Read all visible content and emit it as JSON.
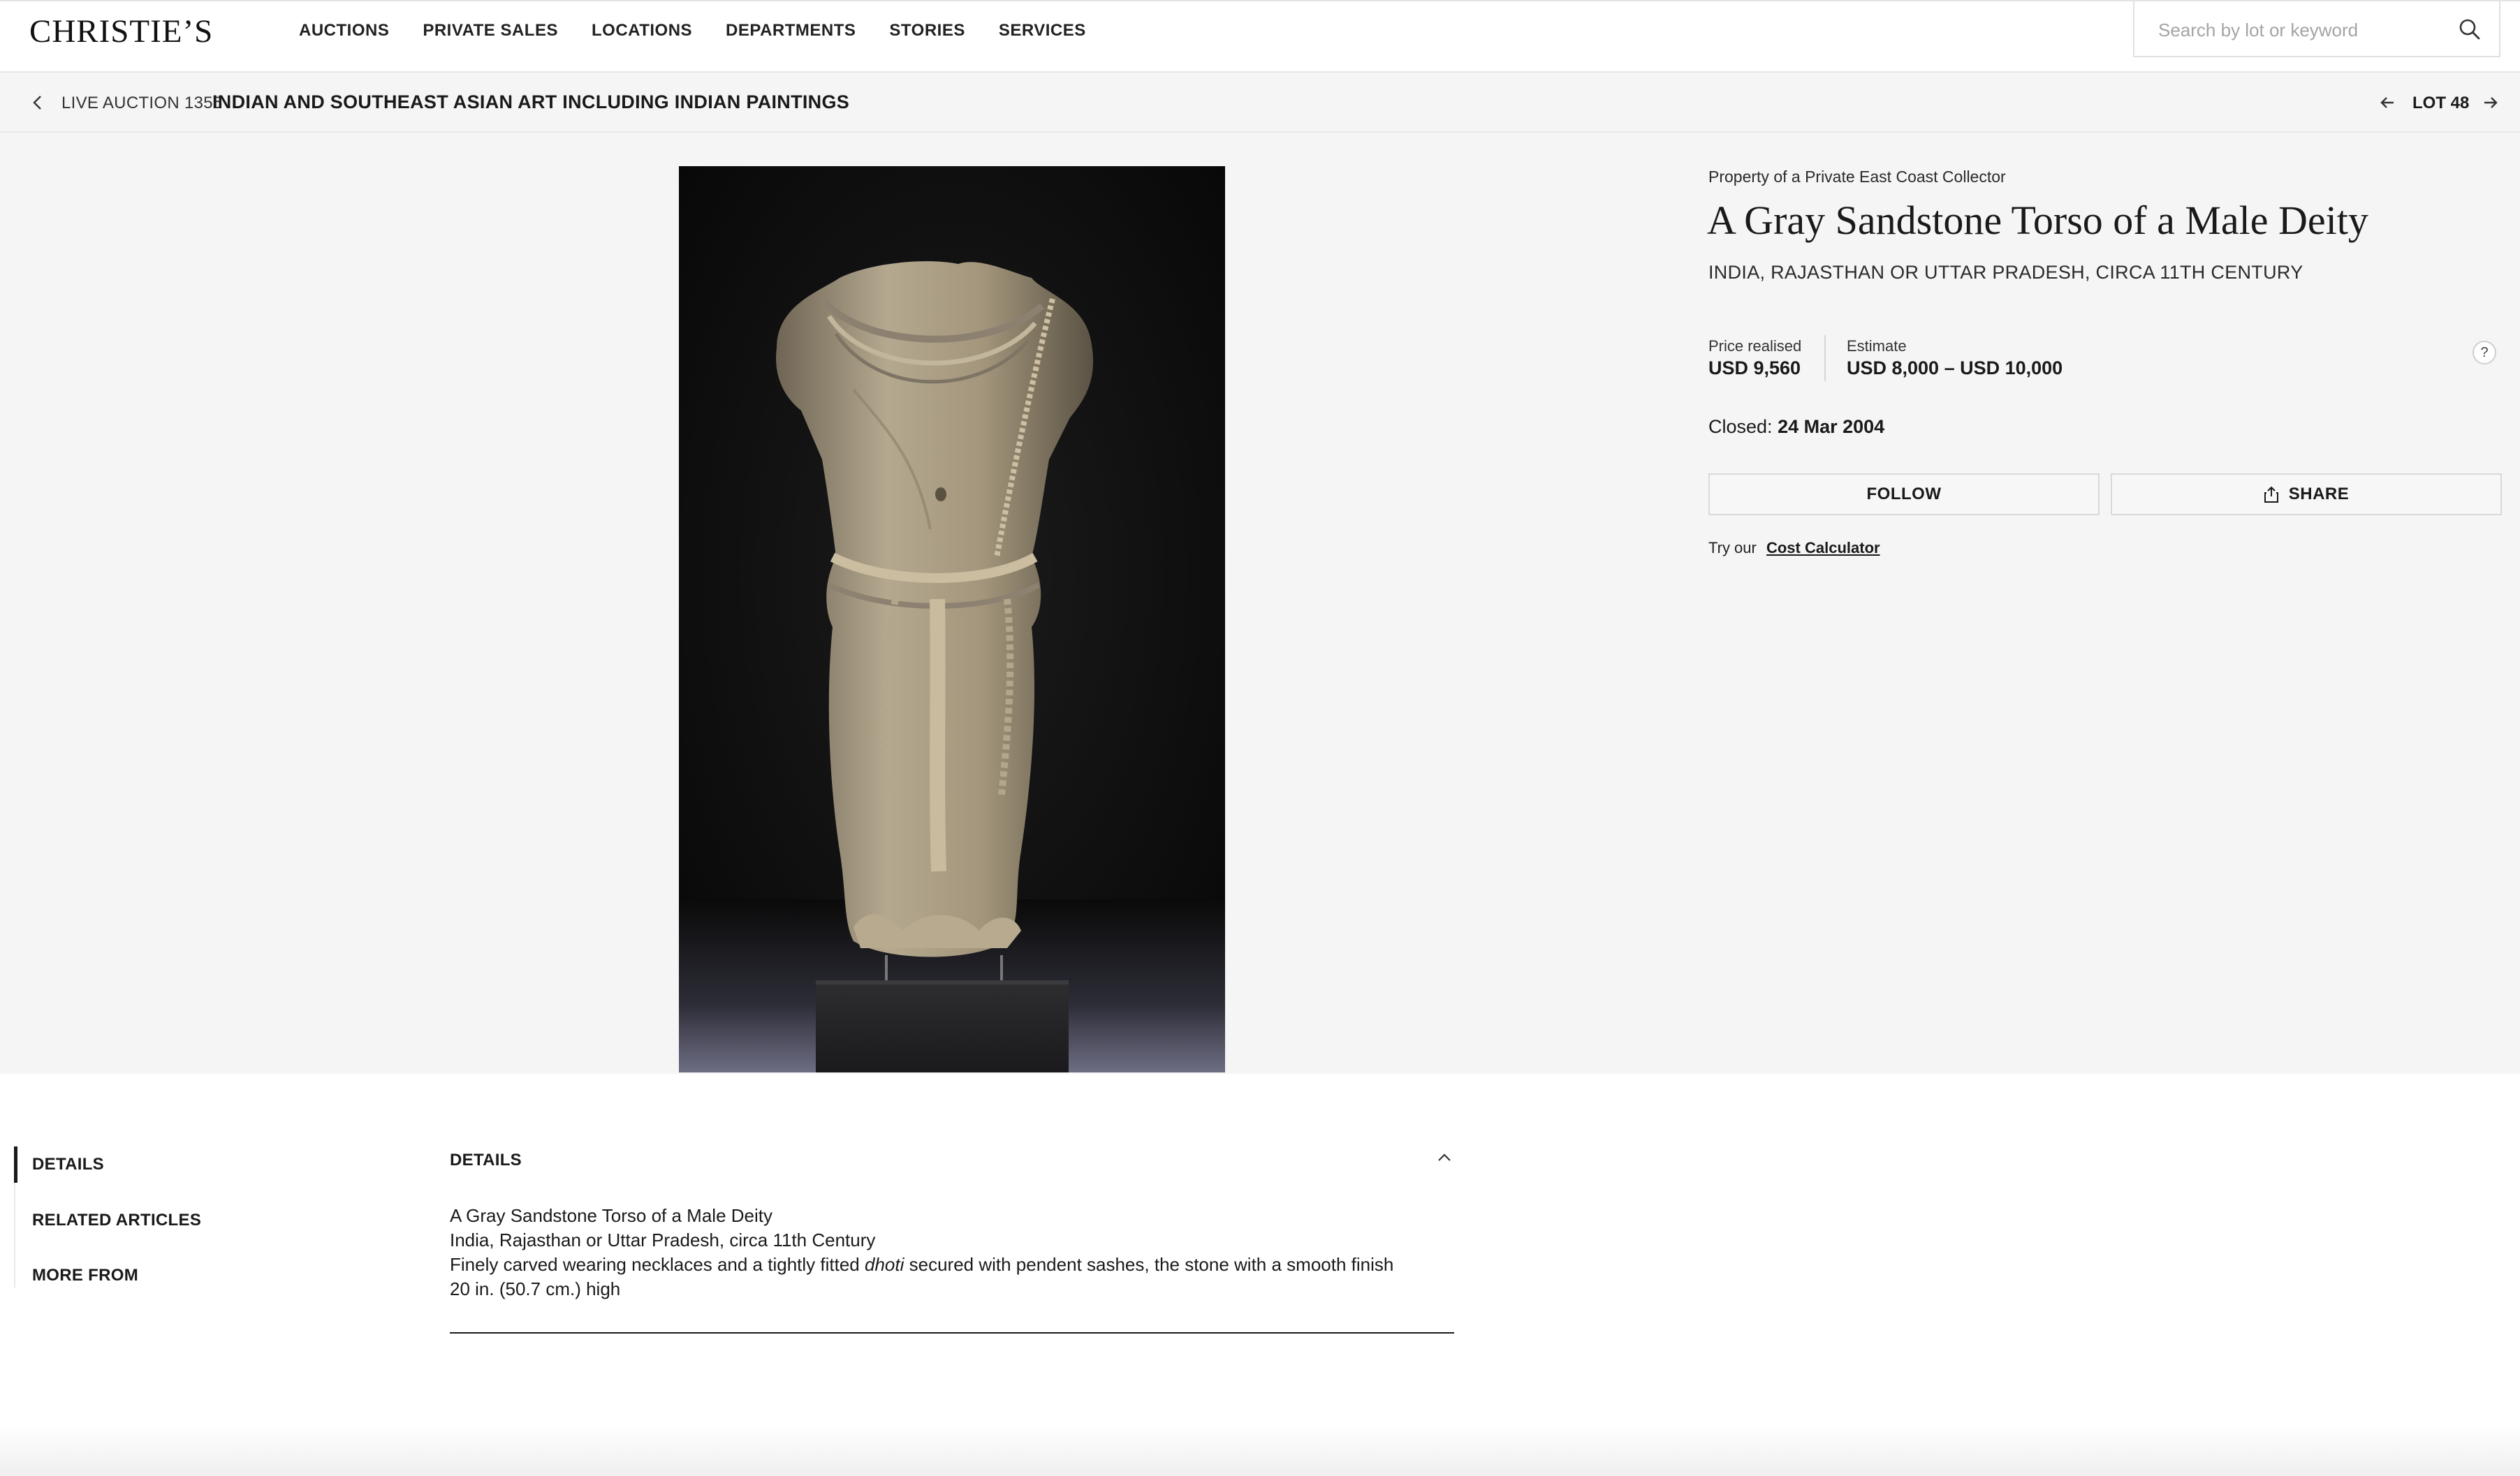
{
  "header": {
    "logo": "CHRISTIE’S",
    "nav": [
      "AUCTIONS",
      "PRIVATE SALES",
      "LOCATIONS",
      "DEPARTMENTS",
      "STORIES",
      "SERVICES"
    ],
    "search_placeholder": "Search by lot or keyword",
    "search_icon": "magnifier"
  },
  "breadcrumb": {
    "sale_label": "LIVE AUCTION 1355",
    "sale_title": "INDIAN AND SOUTHEAST ASIAN ART INCLUDING INDIAN PAINTINGS",
    "lot": "LOT 48"
  },
  "lot": {
    "provenance": "Property of a Private East Coast Collector",
    "title": "A Gray Sandstone Torso of a Male Deity",
    "subtitle": "INDIA, RAJASTHAN OR UTTAR PRADESH, CIRCA 11TH CENTURY",
    "price_label": "Price realised",
    "price_value": "USD 9,560",
    "estimate_label": "Estimate",
    "estimate_value": "USD 8,000 – USD 10,000",
    "help": "?",
    "closed_label": "Closed:",
    "closed_date": "24 Mar 2004",
    "follow_label": "FOLLOW",
    "share_label": "SHARE",
    "calc_prefix": "Try our",
    "calc_link": "Cost Calculator"
  },
  "sidebar": {
    "items": [
      "DETAILS",
      "RELATED ARTICLES",
      "MORE FROM"
    ]
  },
  "details": {
    "heading": "DETAILS",
    "line1": "A Gray Sandstone Torso of a Male Deity",
    "line2": "India, Rajasthan or Uttar Pradesh, circa 11th Century",
    "line3_before": "Finely carved wearing necklaces and a tightly fitted",
    "line3_italic": "dhoti",
    "line3_after": "secured with pendent sashes, the stone with a smooth finish",
    "line4": "20 in. (50.7 cm.) high"
  },
  "colors": {
    "background_band": "#f5f5f5",
    "text": "#1a1a1a",
    "image_backdrop": "#0b0b0b"
  }
}
